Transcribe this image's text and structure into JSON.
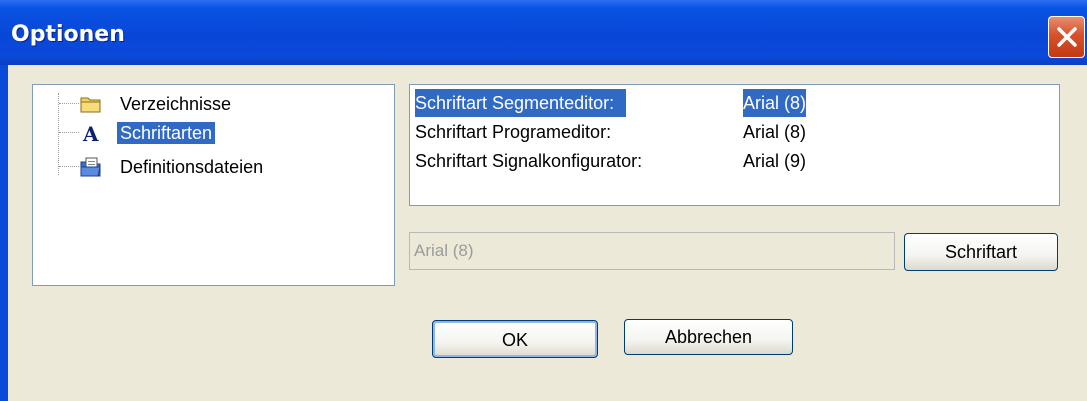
{
  "window": {
    "title": "Optionen"
  },
  "tree": {
    "items": [
      {
        "label": "Verzeichnisse",
        "icon": "folder-icon",
        "selected": false
      },
      {
        "label": "Schriftarten",
        "icon": "font-icon",
        "selected": true
      },
      {
        "label": "Definitionsdateien",
        "icon": "definition-file-icon",
        "selected": false
      }
    ]
  },
  "fonts": {
    "rows": [
      {
        "name": "Schriftart Segmenteditor:",
        "value": "Arial (8)",
        "selected": true
      },
      {
        "name": "Schriftart Programeditor:",
        "value": "Arial (8)",
        "selected": false
      },
      {
        "name": "Schriftart Signalkonfigurator:",
        "value": "Arial (9)",
        "selected": false
      }
    ],
    "current_value": "Arial (8)",
    "font_button": "Schriftart"
  },
  "buttons": {
    "ok": "OK",
    "cancel": "Abbrechen"
  },
  "colors": {
    "selection": "#316ac5",
    "titlebar": "#0a4ad8",
    "close": "#d6512a",
    "dialog_bg": "#ece9d8"
  }
}
